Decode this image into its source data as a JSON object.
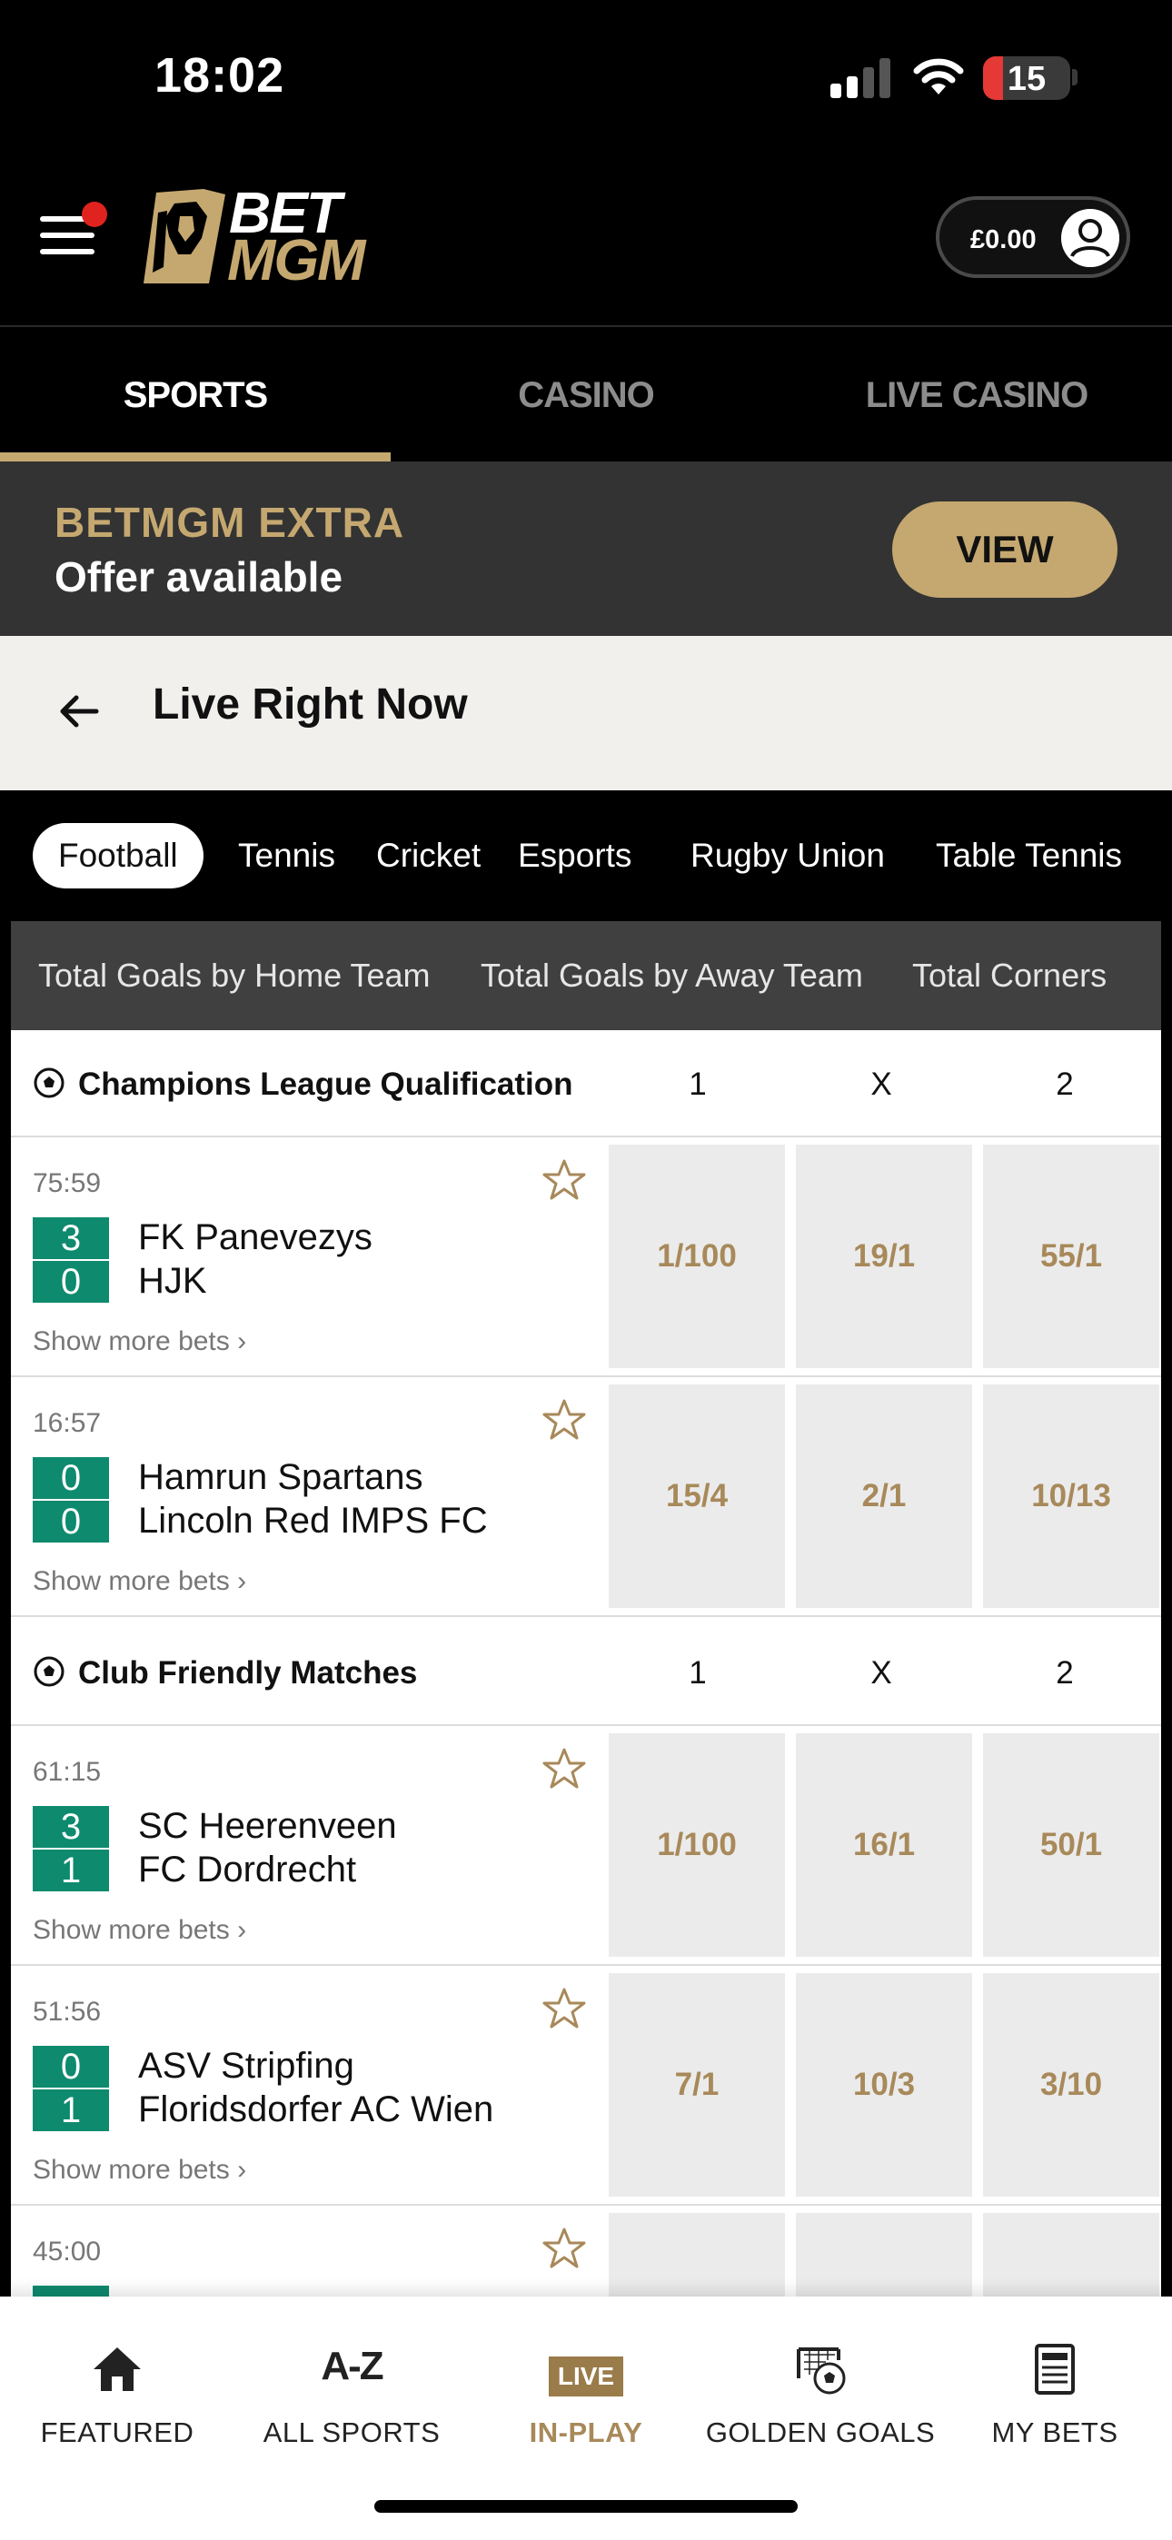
{
  "status_bar": {
    "time": "18:02",
    "battery": "15"
  },
  "header": {
    "logo_top": "BET",
    "logo_bottom": "MGM",
    "balance": "£0.00"
  },
  "nav": {
    "tabs": [
      {
        "label": "SPORTS"
      },
      {
        "label": "CASINO"
      },
      {
        "label": "LIVE CASINO"
      }
    ]
  },
  "promo": {
    "title": "BETMGM EXTRA",
    "subtitle": "Offer available",
    "button": "VIEW"
  },
  "page": {
    "title": "Live Right Now"
  },
  "sports": [
    "Football",
    "Tennis",
    "Cricket",
    "Esports",
    "Rugby Union",
    "Table Tennis"
  ],
  "markets": [
    "Total Goals by Home Team",
    "Total Goals by Away Team",
    "Total Corners"
  ],
  "competitions": [
    {
      "name": "Champions League Qualification",
      "cols": [
        "1",
        "X",
        "2"
      ],
      "events": [
        {
          "time": "75:59",
          "home": "FK Panevezys",
          "away": "HJK",
          "home_score": "3",
          "away_score": "0",
          "odds": [
            "1/100",
            "19/1",
            "55/1"
          ],
          "more": "Show more bets"
        },
        {
          "time": "16:57",
          "home": "Hamrun Spartans",
          "away": "Lincoln Red IMPS FC",
          "home_score": "0",
          "away_score": "0",
          "odds": [
            "15/4",
            "2/1",
            "10/13"
          ],
          "more": "Show more bets"
        }
      ]
    },
    {
      "name": "Club Friendly Matches",
      "cols": [
        "1",
        "X",
        "2"
      ],
      "events": [
        {
          "time": "61:15",
          "home": "SC Heerenveen",
          "away": "FC Dordrecht",
          "home_score": "3",
          "away_score": "1",
          "odds": [
            "1/100",
            "16/1",
            "50/1"
          ],
          "more": "Show more bets"
        },
        {
          "time": "51:56",
          "home": "ASV Stripfing",
          "away": "Floridsdorfer AC Wien",
          "home_score": "0",
          "away_score": "1",
          "odds": [
            "7/1",
            "10/3",
            "3/10"
          ],
          "more": "Show more bets"
        },
        {
          "time": "45:00"
        }
      ]
    }
  ],
  "tabbar": {
    "items": [
      {
        "label": "FEATURED",
        "icon": "home-icon"
      },
      {
        "label": "ALL SPORTS",
        "icon": "a-z-icon",
        "glyph": "A-Z"
      },
      {
        "label": "IN-PLAY",
        "icon": "live-icon",
        "glyph": "LIVE"
      },
      {
        "label": "GOLDEN GOALS",
        "icon": "golden-goals-icon"
      },
      {
        "label": "MY BETS",
        "icon": "betslip-icon"
      }
    ]
  },
  "colors": {
    "gold": "#c5a870",
    "score_green": "#0e8a6e",
    "odds_text": "#a8895a"
  }
}
